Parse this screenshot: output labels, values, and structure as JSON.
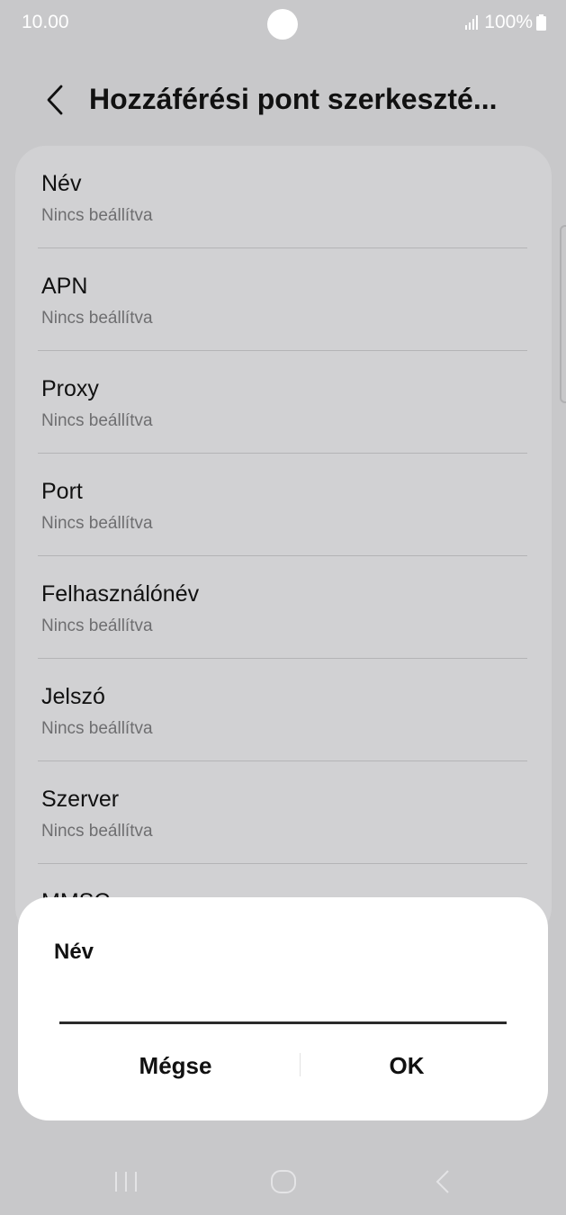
{
  "status_bar": {
    "time": "10.00",
    "battery": "100%"
  },
  "header": {
    "title": "Hozzáférési pont szerkeszté..."
  },
  "settings": [
    {
      "title": "Név",
      "value": "Nincs beállítva"
    },
    {
      "title": "APN",
      "value": "Nincs beállítva"
    },
    {
      "title": "Proxy",
      "value": "Nincs beállítva"
    },
    {
      "title": "Port",
      "value": "Nincs beállítva"
    },
    {
      "title": "Felhasználónév",
      "value": "Nincs beállítva"
    },
    {
      "title": "Jelszó",
      "value": "Nincs beállítva"
    },
    {
      "title": "Szerver",
      "value": "Nincs beállítva"
    },
    {
      "title": "MMSC",
      "value": ""
    }
  ],
  "dialog": {
    "title": "Név",
    "input_value": "",
    "cancel_label": "Mégse",
    "ok_label": "OK"
  },
  "icons": {
    "back": "chevron-left-icon",
    "nav_recents": "recents-icon",
    "nav_home": "home-icon",
    "nav_back": "back-icon"
  },
  "colors": {
    "background": "#c8c8ca",
    "card": "#d1d1d3",
    "dialog": "#ffffff",
    "text": "#111111",
    "secondary_text": "#6e6e70"
  }
}
